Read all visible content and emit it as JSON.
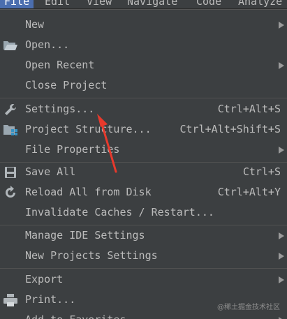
{
  "menubar": {
    "items": [
      "File",
      "Edit",
      "View",
      "Navigate",
      "Code",
      "Analyze"
    ]
  },
  "menu": {
    "items": [
      {
        "label": "New",
        "shortcut": "",
        "icon": "",
        "submenu": true
      },
      {
        "label": "Open...",
        "shortcut": "",
        "icon": "folder-open-icon",
        "submenu": false
      },
      {
        "label": "Open Recent",
        "shortcut": "",
        "icon": "",
        "submenu": true
      },
      {
        "label": "Close Project",
        "shortcut": "",
        "icon": "",
        "submenu": false
      },
      {
        "label": "Settings...",
        "shortcut": "Ctrl+Alt+S",
        "icon": "wrench-icon",
        "submenu": false
      },
      {
        "label": "Project Structure...",
        "shortcut": "Ctrl+Alt+Shift+S",
        "icon": "project-structure-icon",
        "submenu": false
      },
      {
        "label": "File Properties",
        "shortcut": "",
        "icon": "",
        "submenu": true
      },
      {
        "label": "Save All",
        "shortcut": "Ctrl+S",
        "icon": "save-icon",
        "submenu": false
      },
      {
        "label": "Reload All from Disk",
        "shortcut": "Ctrl+Alt+Y",
        "icon": "reload-icon",
        "submenu": false
      },
      {
        "label": "Invalidate Caches / Restart...",
        "shortcut": "",
        "icon": "",
        "submenu": false
      },
      {
        "label": "Manage IDE Settings",
        "shortcut": "",
        "icon": "",
        "submenu": true
      },
      {
        "label": "New Projects Settings",
        "shortcut": "",
        "icon": "",
        "submenu": true
      },
      {
        "label": "Export",
        "shortcut": "",
        "icon": "",
        "submenu": true
      },
      {
        "label": "Print...",
        "shortcut": "",
        "icon": "printer-icon",
        "submenu": false
      },
      {
        "label": "Add to Favorites",
        "shortcut": "",
        "icon": "",
        "submenu": true
      }
    ]
  },
  "watermark": "@稀土掘金技术社区",
  "colors": {
    "background": "#3c3f41",
    "text": "#bbbbbb",
    "active_menu": "#4b6eaf",
    "annotation_arrow": "#e8392c"
  }
}
